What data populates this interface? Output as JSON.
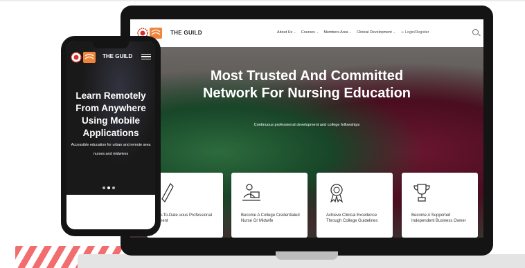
{
  "site": {
    "brand": "THE GUILD",
    "nav": {
      "items": [
        "About Us",
        "Courses",
        "Members Area",
        "Clinical Development"
      ],
      "login": "Login/Register"
    },
    "hero": {
      "title": "Most Trusted And Committed Network For Nursing Education",
      "subtitle": "Continuous professional development and college fellowships"
    },
    "cards": [
      {
        "icon": "pencil-icon",
        "title": "Up-To-Date uous Professional pment"
      },
      {
        "icon": "laptop-user-icon",
        "title": "Become A College Credentialed Nurse Or Midwife"
      },
      {
        "icon": "award-badge-icon",
        "title": "Achieve Clinical Excellence Through College Guidelines"
      },
      {
        "icon": "trophy-icon",
        "title": "Become A Supported Independent Business Owner"
      }
    ]
  },
  "mobile": {
    "brand": "THE GUILD",
    "hero": {
      "title": "Learn Remotely From Anywhere Using Mobile Applications",
      "subtitle": "Accessible education for urban and remote area nurses and midwives"
    }
  },
  "colors": {
    "logo_red": "#d8302a",
    "logo_orange": "#f0843a",
    "stripe": "#f26d6d",
    "device_frame": "#141414"
  }
}
